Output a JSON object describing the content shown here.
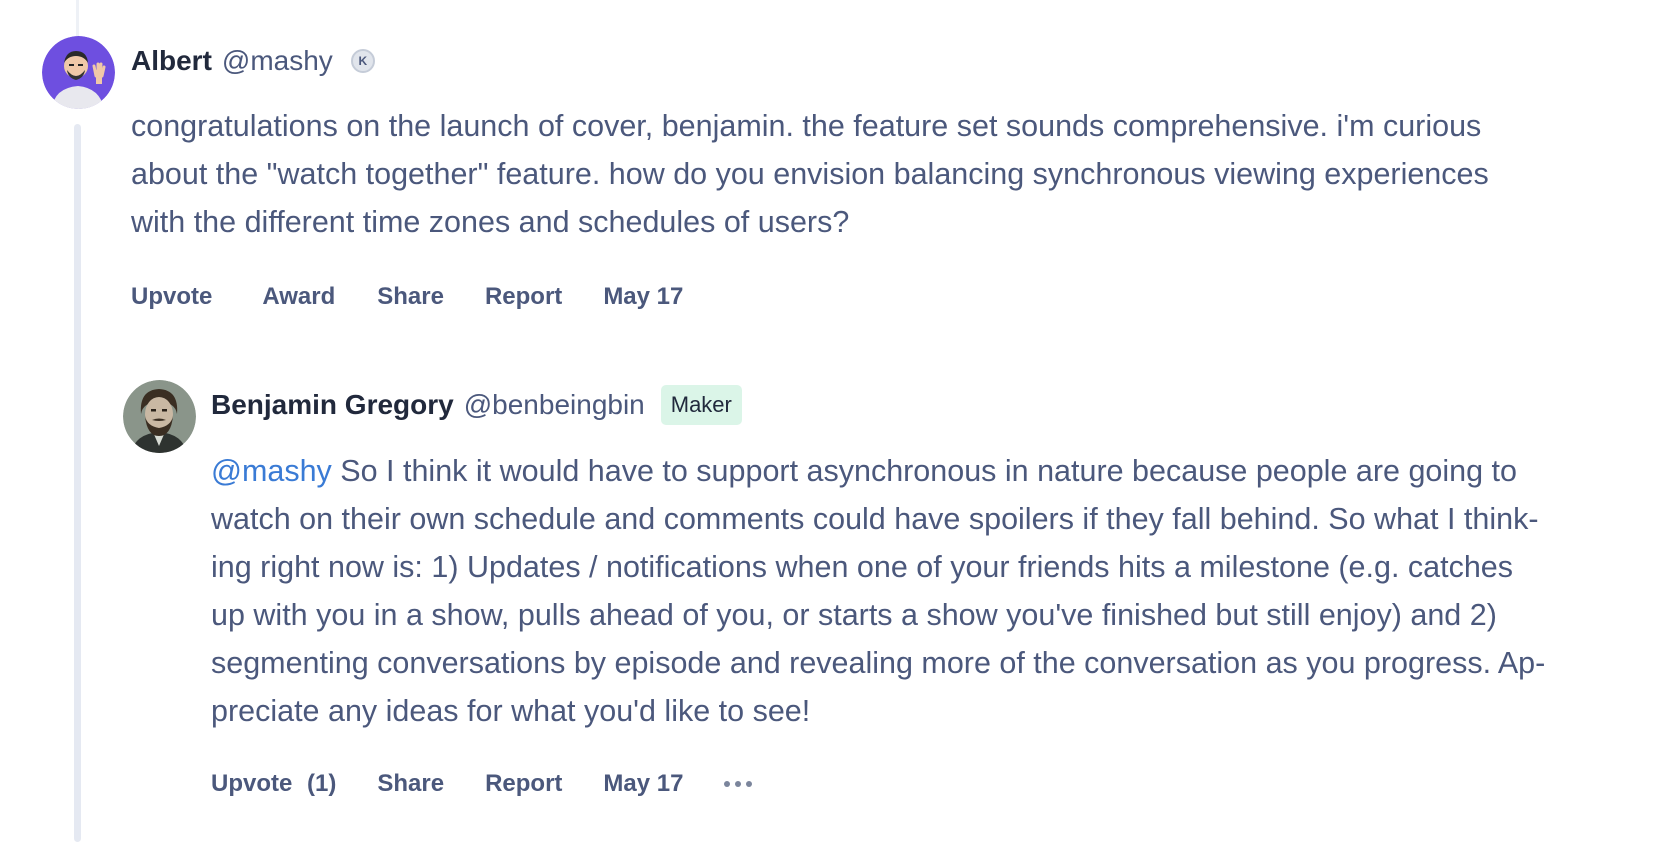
{
  "comments": [
    {
      "author": "Albert",
      "handle": "@mashy",
      "badge": "K",
      "body_lines": [
        "congratulations on the launch of cover, benjamin. the feature set sounds comprehensive. i'm curious",
        "about the \"watch together\" feature. how do you envision balancing synchronous viewing experiences",
        "with the different time zones and schedules of users?"
      ],
      "actions": {
        "upvote": "Upvote",
        "award": "Award",
        "share": "Share",
        "report": "Report",
        "date": "May 17"
      },
      "avatar_color": "#6e4fe0"
    },
    {
      "author": "Benjamin Gregory",
      "handle": "@benbeingbin",
      "badge": "Maker",
      "mention": "@mashy",
      "body_lines": [
        " So I think it would have to support asynchronous in nature because people are going to",
        "watch on their own schedule and comments could have spoilers if they fall behind. So what I think-",
        "ing right now is: 1) Updates / notifications when one of your friends hits a milestone (e.g. catches",
        "up with you in a show, pulls ahead of you, or starts a show you've finished but still enjoy) and 2)",
        "segmenting conversations by episode and revealing more of the conversation as you progress. Ap-",
        "preciate any ideas for what you'd like to see!"
      ],
      "actions": {
        "upvote": "Upvote",
        "upvote_count": "(1)",
        "share": "Share",
        "report": "Report",
        "date": "May 17",
        "more_icon": "more-horizontal-icon"
      },
      "avatar_color": "#5d6a60"
    }
  ],
  "colors": {
    "text": "#4b587c",
    "name": "#21293c",
    "mention": "#3a7bd5",
    "maker_badge_bg": "#dbf5e8",
    "thread_line": "#e5e9f2"
  }
}
